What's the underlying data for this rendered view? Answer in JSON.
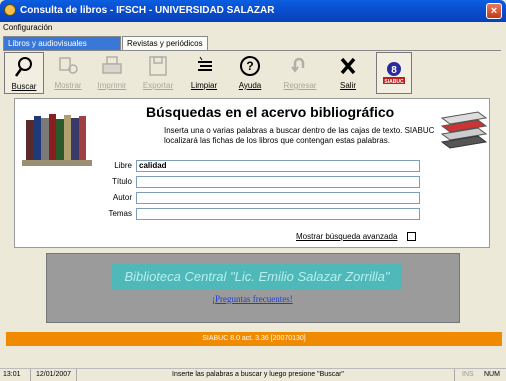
{
  "window": {
    "title": "Consulta de libros - IFSCH - UNIVERSIDAD SALAZAR",
    "close": "×"
  },
  "menu": {
    "items": [
      "Configuración"
    ]
  },
  "tabs": [
    "Libros y audiovisuales",
    "Revistas y periódicos"
  ],
  "toolbar": {
    "buttons": [
      {
        "label": "Buscar",
        "icon": "search-icon",
        "enabled": true
      },
      {
        "label": "Mostrar",
        "icon": "show-icon",
        "enabled": false
      },
      {
        "label": "Imprimir",
        "icon": "printer-icon",
        "enabled": false
      },
      {
        "label": "Exportar",
        "icon": "export-icon",
        "enabled": false
      },
      {
        "label": "Limpiar",
        "icon": "clear-icon",
        "enabled": true
      },
      {
        "label": "Ayuda",
        "icon": "help-icon",
        "enabled": true
      },
      {
        "label": "Regresar",
        "icon": "back-icon",
        "enabled": false
      },
      {
        "label": "Salir",
        "icon": "exit-icon",
        "enabled": true
      },
      {
        "label": "SIABUC",
        "icon": "siabuc-logo-icon",
        "enabled": true
      }
    ]
  },
  "main": {
    "heading": "Búsquedas en el acervo bibliográfico",
    "description": "Inserta una o varias palabras a buscar dentro de las cajas de texto. SIABUC localizará las fichas de los libros que contengan estas palabras.",
    "fields": [
      {
        "label": "Libre",
        "value": "calidad"
      },
      {
        "label": "Título",
        "value": ""
      },
      {
        "label": "Autor",
        "value": ""
      },
      {
        "label": "Temas",
        "value": ""
      }
    ],
    "advanced_label": "Mostrar búsqueda avanzada",
    "advanced_checked": false
  },
  "banner": {
    "library": "Biblioteca Central \"Lic. Emilio Salazar Zorrilla\"",
    "faq": "¡Preguntas frecuentes!"
  },
  "version": "SIABUC 8.0 act. 3.36 [20070130]",
  "status": {
    "time": "13:01",
    "date": "12/01/2007",
    "message": "Inserte las palabras a buscar y luego presione \"Buscar\"",
    "ins": "INS",
    "num": "NUM"
  },
  "colors": {
    "accent": "#0a4fd0",
    "banner": "#4fb8b8",
    "orange": "#f08a00",
    "link": "#1a3fd6"
  }
}
